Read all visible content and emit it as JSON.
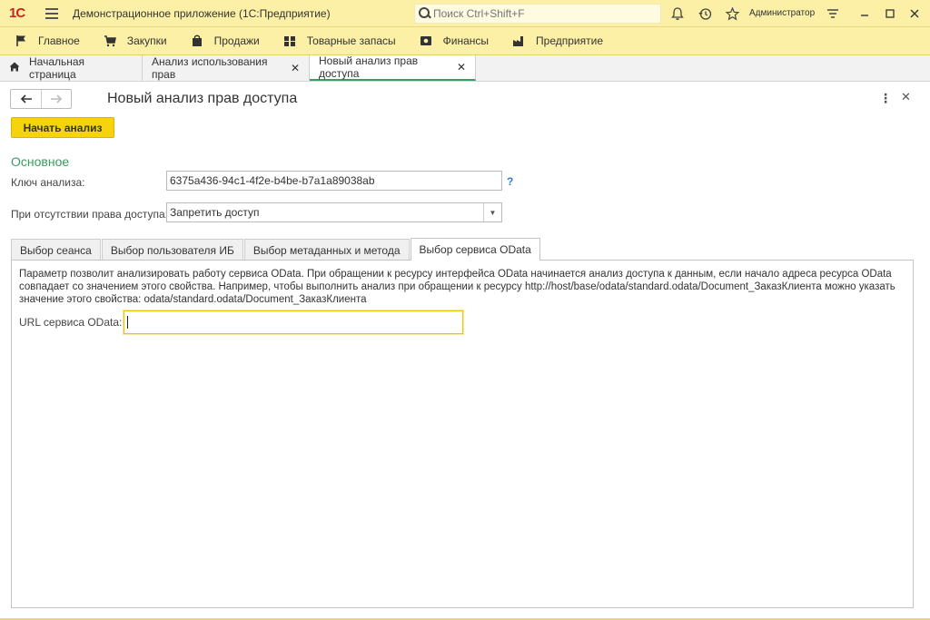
{
  "titlebar": {
    "logo": "1С",
    "app_title": "Демонстрационное приложение  (1С:Предприятие)",
    "search_placeholder": "Поиск Ctrl+Shift+F",
    "user": "Администратор"
  },
  "sections": [
    {
      "label": "Главное",
      "icon": "flag-icon"
    },
    {
      "label": "Закупки",
      "icon": "cart-icon"
    },
    {
      "label": "Продажи",
      "icon": "bag-icon"
    },
    {
      "label": "Товарные запасы",
      "icon": "warehouse-icon"
    },
    {
      "label": "Финансы",
      "icon": "money-icon"
    },
    {
      "label": "Предприятие",
      "icon": "factory-icon"
    }
  ],
  "open_tabs": [
    {
      "label": "Начальная страница"
    },
    {
      "label": "Анализ использования прав"
    },
    {
      "label": "Новый анализ прав доступа"
    }
  ],
  "form": {
    "title": "Новый анализ прав доступа",
    "start_button": "Начать анализ",
    "group_title": "Основное",
    "key_label": "Ключ анализа:",
    "key_value": "6375a436-94c1-4f2e-b4be-b7a1a89038ab",
    "help": "?",
    "access_label": "При отсутствии права доступа:",
    "access_value": "Запретить доступ",
    "tabs": [
      {
        "label": "Выбор сеанса"
      },
      {
        "label": "Выбор пользователя ИБ"
      },
      {
        "label": "Выбор метаданных и метода"
      },
      {
        "label": "Выбор сервиса OData"
      }
    ],
    "description": "Параметр позволит анализировать работу сервиса OData. При обращении к ресурсу интерфейса OData начинается анализ доступа к данным, если начало адреса ресурса OData совпадает со значением этого свойства. Например, чтобы выполнить анализ при обращении к ресурсу http://host/base/odata/standard.odata/Document_ЗаказКлиента можно указать значение этого свойства: odata/standard.odata/Document_ЗаказКлиента",
    "odata_label": "URL сервиса OData:",
    "odata_value": ""
  }
}
